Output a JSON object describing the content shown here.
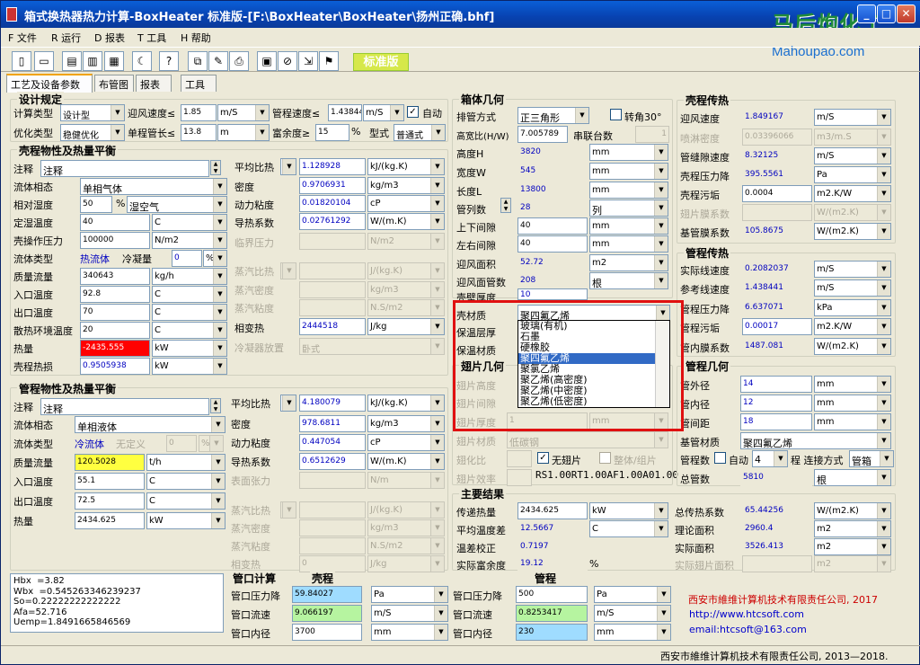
{
  "window": {
    "title": "箱式换热器热力计算-BoxHeater 标准版-[F:\\BoxHeater\\BoxHeater\\扬州正确.bhf]",
    "min": "_",
    "max": "□",
    "close": "✕"
  },
  "watermark": {
    "cn": "马后炮化工",
    "url": "Mahoupao.com"
  },
  "menu": [
    {
      "label": "F 文件"
    },
    {
      "label": "R 运行"
    },
    {
      "label": "D 报表"
    },
    {
      "label": "T 工具"
    },
    {
      "label": "H 帮助"
    }
  ],
  "toolbar": {
    "badge": "标准版",
    "icons": [
      "new-icon",
      "open-icon",
      "save-icon",
      "export-icon",
      "print-preview-icon",
      "moon-icon",
      "help-icon",
      "copy-icon",
      "paste-icon",
      "print-icon",
      "chart-icon",
      "stop-icon",
      "import-icon",
      "exit-icon"
    ]
  },
  "tabs": [
    "工艺及设备参数",
    "布管图",
    "报表",
    "工具"
  ],
  "design": {
    "title": "设计规定",
    "calc_type_label": "计算类型",
    "calc_type": "设计型",
    "face_v_label": "迎风速度≤",
    "face_v": "1.85",
    "face_v_unit": "m/S",
    "tube_v_label": "管程速度≤",
    "tube_v": "1.43844",
    "tube_v_unit": "m/S",
    "auto_label": "自动",
    "opt_label": "优化类型",
    "opt": "稳健优化",
    "len_label": "单程管长≤",
    "len": "13.8",
    "len_unit": "m",
    "margin_label": "富余度≥",
    "margin": "15",
    "margin_unit": "%",
    "form_label": "型式",
    "form": "普通式"
  },
  "shell": {
    "title": "壳程物性及热量平衡",
    "note_label": "注释",
    "note": "注释",
    "phase_label": "流体相态",
    "phase": "单相气体",
    "humid_label": "相对湿度",
    "humid": "50",
    "humid_unit": "%",
    "humid_type": "湿空气",
    "dew_label": "定湿温度",
    "dew": "40",
    "dew_unit": "C",
    "press_label": "壳操作压力",
    "press": "100000",
    "press_unit": "N/m2",
    "fluid_label": "流体类型",
    "fluid": "热流体",
    "cond_label": "冷凝量",
    "cond": "0",
    "cond_unit": "%",
    "flow_label": "质量流量",
    "flow": "340643",
    "flow_unit": "kg/h",
    "tin_label": "入口温度",
    "tin": "92.8",
    "tin_unit": "C",
    "tout_label": "出口温度",
    "tout": "70",
    "tout_unit": "C",
    "env_label": "散热环境温度",
    "env": "20",
    "env_unit": "C",
    "heat_label": "热量",
    "heat": "-2435.555",
    "heat_unit": "kW",
    "loss_label": "壳程热损",
    "loss": "0.9505938",
    "loss_unit": "kW",
    "cp_label": "平均比热",
    "cp": "1.128928",
    "cp_unit": "kJ/(kg.K)",
    "rho_label": "密度",
    "rho": "0.9706931",
    "rho_unit": "kg/m3",
    "mu_label": "动力粘度",
    "mu": "0.01820104",
    "mu_unit": "cP",
    "k_label": "导热系数",
    "k": "0.02761292",
    "k_unit": "W/(m.K)",
    "crit_label": "临界压力",
    "crit_unit": "N/m2",
    "vcp_label": "蒸汽比热",
    "vcp_unit": "J/(kg.K)",
    "vrho_label": "蒸汽密度",
    "vrho_unit": "kg/m3",
    "vmu_label": "蒸汽粘度",
    "vmu_unit": "N.S/m2",
    "lat_label": "相变热",
    "lat": "2444518",
    "lat_unit": "J/kg",
    "cpos_label": "冷凝器放置",
    "cpos": "卧式"
  },
  "tube": {
    "title": "管程物性及热量平衡",
    "note_label": "注释",
    "note": "注释",
    "phase_label": "流体相态",
    "phase": "单相液体",
    "fluid_label": "流体类型",
    "fluid": "冷流体",
    "undef": "无定义",
    "cond": "0",
    "cond_unit": "%",
    "flow_label": "质量流量",
    "flow": "120.5028",
    "flow_unit": "t/h",
    "tin_label": "入口温度",
    "tin": "55.1",
    "tin_unit": "C",
    "tout_label": "出口温度",
    "tout": "72.5",
    "tout_unit": "C",
    "heat_label": "热量",
    "heat": "2434.625",
    "heat_unit": "kW",
    "cp_label": "平均比热",
    "cp": "4.180079",
    "cp_unit": "kJ/(kg.K)",
    "rho_label": "密度",
    "rho": "978.6811",
    "rho_unit": "kg/m3",
    "mu_label": "动力粘度",
    "mu": "0.447054",
    "mu_unit": "cP",
    "k_label": "导热系数",
    "k": "0.6512629",
    "k_unit": "W/(m.K)",
    "st_label": "表面张力",
    "st_unit": "N/m",
    "vcp_label": "蒸汽比热",
    "vcp_unit": "J/(kg.K)",
    "vrho_label": "蒸汽密度",
    "vrho_unit": "kg/m3",
    "vmu_label": "蒸汽粘度",
    "vmu_unit": "N.S/m2",
    "lat_label": "相变热",
    "lat": "0",
    "lat_unit": "J/kg"
  },
  "box": {
    "title": "箱体几何",
    "arr_label": "排管方式",
    "arr": "正三角形",
    "rot_label": "转角30°",
    "hw_label": "高宽比(H/W)",
    "hw": "7.005789",
    "series_label": "串联台数",
    "series": "1",
    "h_label": "高度H",
    "h": "3820",
    "w_label": "宽度W",
    "w": "545",
    "l_label": "长度L",
    "l": "13800",
    "cols_label": "管列数",
    "cols": "28",
    "cols_unit": "列",
    "tb_label": "上下间隙",
    "tb": "40",
    "lr_label": "左右间隙",
    "lr": "40",
    "area_label": "迎风面积",
    "area": "52.72",
    "area_unit": "m2",
    "n_label": "迎风面管数",
    "n": "208",
    "n_unit": "根",
    "wall_label": "壳壁厚度",
    "wall": "10",
    "u_mm": "mm",
    "mat_label": "壳材质",
    "mat": "聚四氟乙烯",
    "ins_label": "保温层厚",
    "insmat_label": "保温材质"
  },
  "dropdown": [
    "玻璃(有机)",
    "石墨",
    "硬橡胶",
    "聚四氟乙烯",
    "聚氯乙烯",
    "聚乙烯(高密度)",
    "聚乙烯(中密度)",
    "聚乙烯(低密度)"
  ],
  "fin": {
    "title": "翅片几何",
    "h_label": "翅片高度",
    "g_label": "翅片间隙",
    "t_label": "翅片厚度",
    "t": "1",
    "t_unit": "mm",
    "mat_label": "翅片材质",
    "mat": "低碳钢",
    "ratio_label": "翅化比",
    "nofin_label": "无翅片",
    "whole_label": "整体/组片",
    "eff_label": "翅片效率",
    "code": "RS1.00RT1.00AF1.00A01.00"
  },
  "shellht": {
    "title": "壳程传热",
    "fv_label": "迎风速度",
    "fv": "1.849167",
    "fv_unit": "m/S",
    "spray_label": "喷淋密度",
    "spray": "0.03396066",
    "spray_unit": "m3/m.S",
    "gap_label": "管缝隙速度",
    "gap": "8.32125",
    "gap_unit": "m/S",
    "dp_label": "壳程压力降",
    "dp": "395.5561",
    "dp_unit": "Pa",
    "foul_label": "壳程污垢",
    "foul": "0.0004",
    "foul_unit": "m2.K/W",
    "finc_label": "翅片膜系数",
    "finc_unit": "W/(m2.K)",
    "base_label": "基管膜系数",
    "base": "105.8675",
    "base_unit": "W/(m2.K)"
  },
  "tubeht": {
    "title": "管程传热",
    "av_label": "实际线速度",
    "av": "0.2082037",
    "av_unit": "m/S",
    "rv_label": "参考线速度",
    "rv": "1.438441",
    "rv_unit": "m/S",
    "dp_label": "管程压力降",
    "dp": "6.637071",
    "dp_unit": "kPa",
    "foul_label": "管程污垢",
    "foul": "0.00017",
    "foul_unit": "m2.K/W",
    "film_label": "管内膜系数",
    "film": "1487.081",
    "film_unit": "W/(m2.K)"
  },
  "tubegeo": {
    "title": "管程几何",
    "od_label": "管外径",
    "od": "14",
    "id_label": "管内径",
    "id": "12",
    "pitch_label": "管间距",
    "pitch": "18",
    "unit": "mm",
    "mat_label": "基管材质",
    "mat": "聚四氟乙烯",
    "np_label": "管程数",
    "auto_label": "自动",
    "np": "4",
    "conn_label": "程 连接方式",
    "conn": "管箱",
    "total_label": "总管数",
    "total": "5810",
    "total_unit": "根"
  },
  "results": {
    "title": "主要结果",
    "q_label": "传递热量",
    "q": "2434.625",
    "q_unit": "kW",
    "dt_label": "平均温度差",
    "dt": "12.5667",
    "dt_unit": "C",
    "f_label": "温差校正",
    "f": "0.7197",
    "marg_label": "实际富余度",
    "marg": "19.12",
    "marg_unit": "%",
    "u_label": "总传热系数",
    "u": "65.44256",
    "u_unit": "W/(m2.K)",
    "ta_label": "理论面积",
    "ta": "2960.4",
    "ta_unit": "m2",
    "aa_label": "实际面积",
    "aa": "3526.413",
    "aa_unit": "m2",
    "fa_label": "实际翅片面积",
    "fa_unit": "m2"
  },
  "nozzle": {
    "title": "管口计算",
    "shell_label": "壳程",
    "tube_label": "管程",
    "dp_label": "管口压力降",
    "v_label": "管口流速",
    "d_label": "管口内径",
    "s_dp": "59.84027",
    "s_dp_unit": "Pa",
    "s_v": "9.066197",
    "s_v_unit": "m/S",
    "s_d": "3700",
    "s_d_unit": "mm",
    "t_dp": "500",
    "t_dp_unit": "Pa",
    "t_v": "0.8253417",
    "t_v_unit": "m/S",
    "t_d": "230",
    "t_d_unit": "mm"
  },
  "memo": "Hbx  =3.82\nWbx  =0.545263346239237\nSo=0.22222222222222\nAfa=52.716\nUemp=1.8491665846569",
  "company": {
    "name": "西安市維维计算机技术有限责任公司, 2017",
    "web": "http://www.htcsoft.com",
    "email": "email:htcsoft@163.com",
    "status": "西安市維维计算机技术有限责任公司, 2013—2018."
  }
}
